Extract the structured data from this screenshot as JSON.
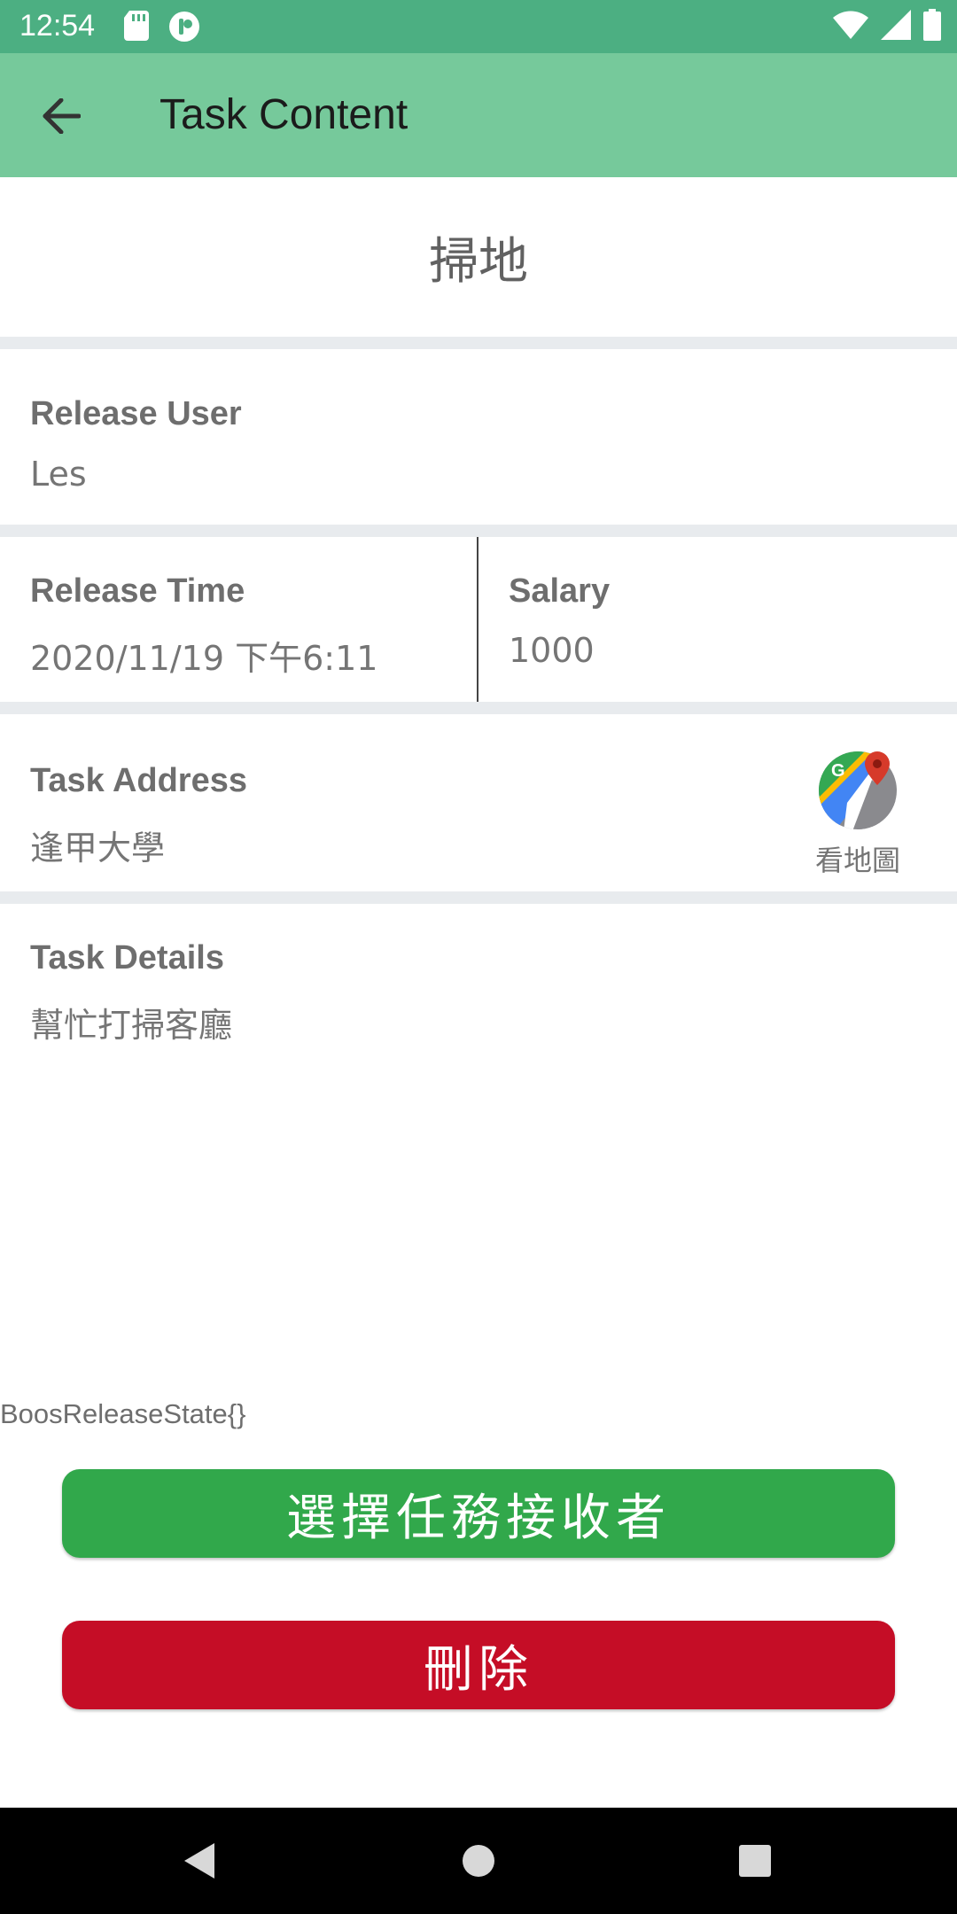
{
  "status_bar": {
    "time": "12:54",
    "icons": [
      "sd-card-icon",
      "app-notification-icon",
      "wifi-icon",
      "signal-icon",
      "battery-icon"
    ]
  },
  "app_bar": {
    "title": "Task Content",
    "back_icon": "arrow-back-icon"
  },
  "task": {
    "title": "掃地",
    "release_user_label": "Release User",
    "release_user": "Les",
    "release_time_label": "Release Time",
    "release_time": "2020/11/19 下午6:11",
    "salary_label": "Salary",
    "salary": "1000",
    "address_label": "Task Address",
    "address": "逢甲大學",
    "map_button_label": "看地圖",
    "details_label": "Task Details",
    "details": "幫忙打掃客廳"
  },
  "state_text": "BoosReleaseState{}",
  "actions": {
    "choose_receiver": "選擇任務接收者",
    "delete": "刪除"
  },
  "colors": {
    "status_bar": "#4caf82",
    "app_bar": "#76c99b",
    "primary_button": "#31a84b",
    "danger_button": "#c50d26",
    "divider": "#e8ebee"
  }
}
